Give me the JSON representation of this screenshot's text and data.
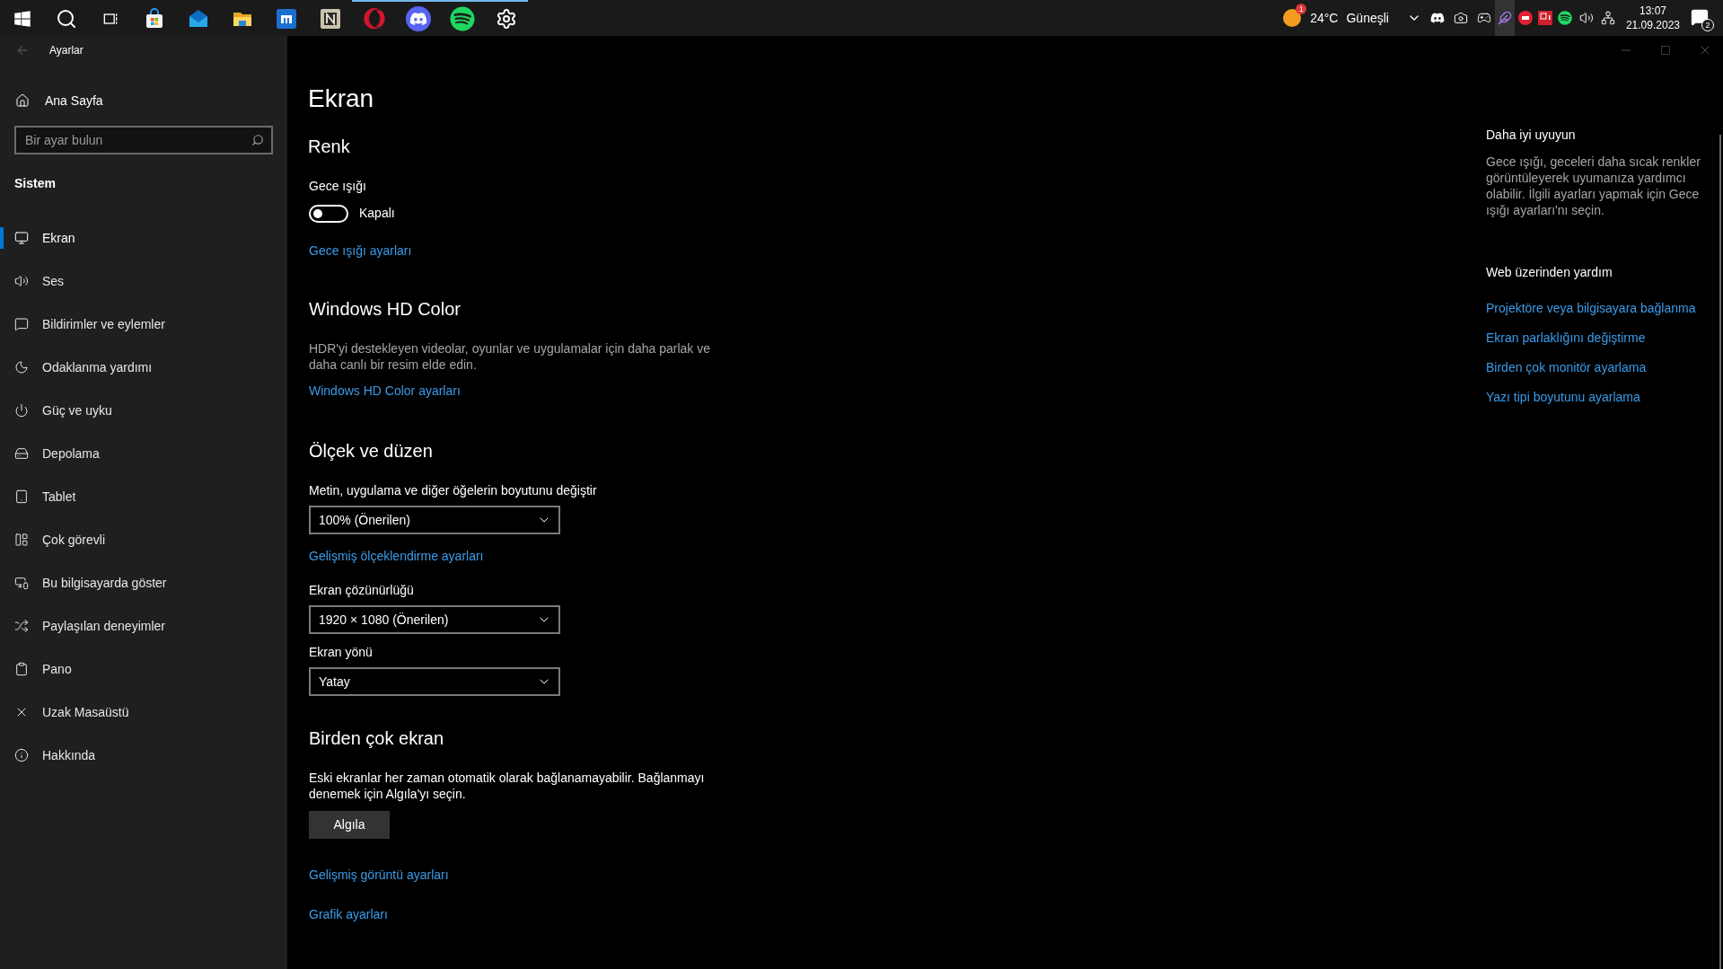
{
  "taskbar": {
    "apps": [
      {
        "running": false
      },
      {
        "running": false
      },
      {
        "running": false
      },
      {
        "running": false
      },
      {
        "running": false
      },
      {
        "running": false
      },
      {
        "running": false
      },
      {
        "running": false
      },
      {
        "running": true
      },
      {
        "running": true
      },
      {
        "running": true
      },
      {
        "running": true
      }
    ],
    "weather": {
      "badge": "1",
      "temperature": "24°C",
      "condition": "Güneşli"
    },
    "clock": {
      "time": "13:07",
      "date": "21.09.2023"
    },
    "notifications": {
      "count": "2"
    }
  },
  "window": {
    "title": "Ayarlar"
  },
  "sidebar": {
    "home": "Ana Sayfa",
    "search": {
      "placeholder": "Bir ayar bulun"
    },
    "section": "Sistem",
    "items": [
      {
        "label": "Ekran",
        "selected": true
      },
      {
        "label": "Ses",
        "selected": false
      },
      {
        "label": "Bildirimler ve eylemler",
        "selected": false
      },
      {
        "label": "Odaklanma yardımı",
        "selected": false
      },
      {
        "label": "Güç ve uyku",
        "selected": false
      },
      {
        "label": "Depolama",
        "selected": false
      },
      {
        "label": "Tablet",
        "selected": false
      },
      {
        "label": "Çok görevli",
        "selected": false
      },
      {
        "label": "Bu bilgisayarda göster",
        "selected": false
      },
      {
        "label": "Paylaşılan deneyimler",
        "selected": false
      },
      {
        "label": "Pano",
        "selected": false
      },
      {
        "label": "Uzak Masaüstü",
        "selected": false
      },
      {
        "label": "Hakkında",
        "selected": false
      }
    ]
  },
  "page": {
    "title": "Ekran"
  },
  "color": {
    "heading": "Renk",
    "night_light": {
      "label": "Gece ışığı",
      "on": false,
      "state_text": "Kapalı"
    },
    "link": "Gece ışığı ayarları"
  },
  "hd_color": {
    "heading": "Windows HD Color",
    "description": "HDR'yi destekleyen videolar, oyunlar ve uygulamalar için daha parlak ve daha canlı bir resim elde edin.",
    "link": "Windows HD Color ayarları"
  },
  "scale": {
    "heading": "Ölçek ve düzen",
    "size": {
      "label": "Metin, uygulama ve diğer öğelerin boyutunu değiştir",
      "value": "100% (Önerilen)"
    },
    "advanced_link": "Gelişmiş ölçeklendirme ayarları",
    "resolution": {
      "label": "Ekran çözünürlüğü",
      "value": "1920 × 1080 (Önerilen)"
    },
    "orientation": {
      "label": "Ekran yönü",
      "value": "Yatay"
    }
  },
  "multi": {
    "heading": "Birden çok ekran",
    "description": "Eski ekranlar her zaman otomatik olarak bağlanamayabilir. Bağlanmayı denemek için Algıla'yı seçin.",
    "button": "Algıla",
    "links": [
      "Gelişmiş görüntü ayarları",
      "Grafik ayarları"
    ]
  },
  "side_panel": {
    "sleep": {
      "heading": "Daha iyi uyuyun",
      "text": "Gece ışığı, geceleri daha sıcak renkler görüntüleyerek uyumanıza yardımcı olabilir. İlgili ayarları yapmak için Gece ışığı ayarları'nı seçin."
    },
    "web_help": {
      "heading": "Web üzerinden yardım",
      "links": [
        "Projektöre veya bilgisayara bağlanma",
        "Ekran parlaklığını değiştirme",
        "Birden çok monitör ayarlama",
        "Yazı tipi boyutunu ayarlama"
      ]
    }
  }
}
